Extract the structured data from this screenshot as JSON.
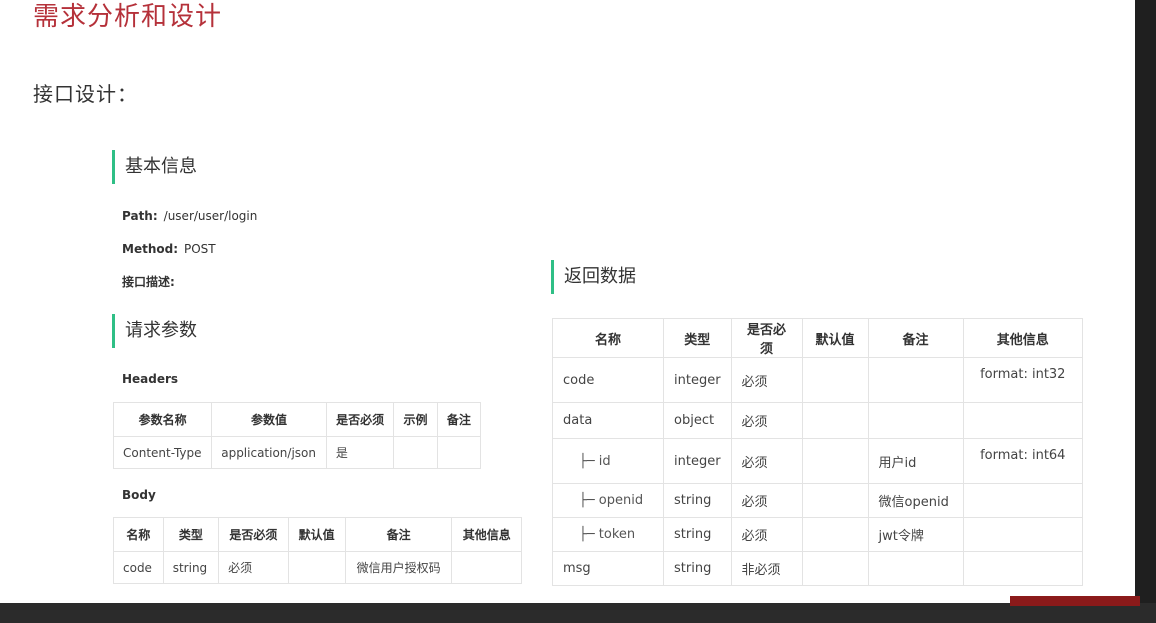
{
  "title": "需求分析和设计",
  "subtitle": "接口设计：",
  "basic_info": {
    "heading": "基本信息",
    "path_label": "Path:",
    "path_value": "/user/user/login",
    "method_label": "Method:",
    "method_value": "POST",
    "desc_label": "接口描述:"
  },
  "request_params": {
    "heading": "请求参数",
    "headers_label": "Headers",
    "headers_table": {
      "columns": [
        "参数名称",
        "参数值",
        "是否必须",
        "示例",
        "备注"
      ],
      "rows": [
        [
          "Content-Type",
          "application/json",
          "是",
          "",
          ""
        ]
      ]
    },
    "body_label": "Body",
    "body_table": {
      "columns": [
        "名称",
        "类型",
        "是否必须",
        "默认值",
        "备注",
        "其他信息"
      ],
      "rows": [
        [
          "code",
          "string",
          "必须",
          "",
          "微信用户授权码",
          ""
        ]
      ]
    }
  },
  "response": {
    "heading": "返回数据",
    "table": {
      "columns": [
        "名称",
        "类型",
        "是否必须",
        "默认值",
        "备注",
        "其他信息"
      ],
      "rows": [
        [
          "code",
          "integer",
          "必须",
          "",
          "",
          "format: int32"
        ],
        [
          "data",
          "object",
          "必须",
          "",
          "",
          ""
        ],
        [
          "├─ id",
          "integer",
          "必须",
          "",
          "用户id",
          "format: int64"
        ],
        [
          "├─ openid",
          "string",
          "必须",
          "",
          "微信openid",
          ""
        ],
        [
          "├─ token",
          "string",
          "必须",
          "",
          "jwt令牌",
          ""
        ],
        [
          "msg",
          "string",
          "非必须",
          "",
          "",
          ""
        ]
      ]
    }
  }
}
